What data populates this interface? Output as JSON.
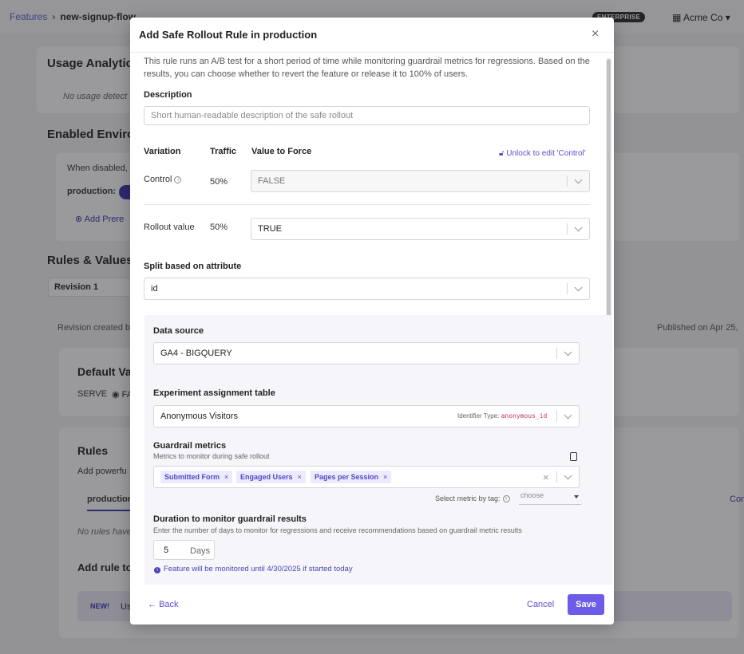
{
  "background": {
    "breadcrumb": {
      "root": "Features",
      "separator": "›",
      "current": "new-signup-flow"
    },
    "enterprise_badge": "ENTERPRISE",
    "org_name": "Acme Co",
    "usage_title": "Usage Analytics",
    "usage_empty": "No usage detect",
    "envs_title": "Enabled Environ",
    "envs_desc": "When disabled,",
    "env_production": "production:",
    "add_prereq": "Add Prere",
    "rules_values_title": "Rules & Values",
    "revision": "Revision 1",
    "revision_created": "Revision created b",
    "published_on": "Published on Apr 25,",
    "default_value_title": "Default Va",
    "serve_label": "SERVE",
    "serve_value": "FA",
    "rules_title": "Rules",
    "rules_desc": "Add powerfu",
    "tab_production": "production",
    "tab_right": "Con",
    "no_rules": "No rules have",
    "add_rule": "Add rule to",
    "new_badge": "NEW!",
    "new_text": "Us"
  },
  "modal": {
    "title": "Add Safe Rollout Rule in production",
    "close_label": "×",
    "intro": "This rule runs an A/B test for a short period of time while monitoring guardrail metrics for regressions. Based on the results, you can choose whether to revert the feature or release it to 100% of users.",
    "description": {
      "label": "Description",
      "placeholder": "Short human-readable description of the safe rollout",
      "value": ""
    },
    "variations": {
      "headers": {
        "variation": "Variation",
        "traffic": "Traffic",
        "value": "Value to Force"
      },
      "unlock_label": "Unlock to edit 'Control'",
      "rows": [
        {
          "name": "Control",
          "traffic": "50%",
          "value": "FALSE"
        },
        {
          "name": "Rollout value",
          "traffic": "50%",
          "value": "TRUE"
        }
      ]
    },
    "split": {
      "label": "Split based on attribute",
      "value": "id"
    },
    "data_source": {
      "label": "Data source",
      "value": "GA4 - BIGQUERY"
    },
    "assignment_table": {
      "label": "Experiment assignment table",
      "value": "Anonymous Visitors",
      "identifier_label": "Identifier Type:",
      "identifier_value": "anonymous_id"
    },
    "guardrails": {
      "label": "Guardrail metrics",
      "help": "Metrics to monitor during safe rollout",
      "tags": [
        "Submitted Form",
        "Engaged Users",
        "Pages per Session"
      ],
      "tag_select_label": "Select metric by tag:",
      "tag_select_placeholder": "choose"
    },
    "duration": {
      "label": "Duration to monitor guardrail results",
      "help": "Enter the number of days to monitor for regressions and receive recommendations based on guardrail metric results",
      "value": "5",
      "unit": "Days",
      "note": "Feature will be monitored until 4/30/2025 if started today"
    },
    "footer": {
      "back": "Back",
      "cancel": "Cancel",
      "save": "Save"
    }
  },
  "colors": {
    "accent": "#6c5ce7",
    "link": "#5b4fd1",
    "tag_bg": "#ecebfd",
    "code": "#c9306b"
  }
}
